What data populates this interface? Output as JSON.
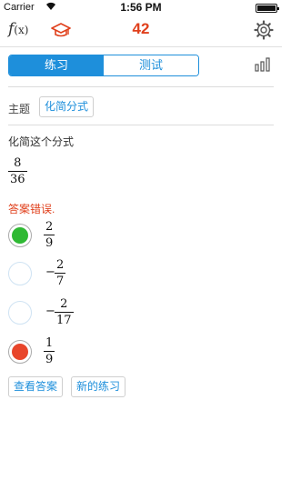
{
  "status": {
    "carrier": "Carrier",
    "time": "1:56 PM"
  },
  "navbar": {
    "fx_icon_main": "f",
    "fx_icon_arg": "(x)",
    "score": "42"
  },
  "tabs": {
    "practice": "练习",
    "test": "测试"
  },
  "topic": {
    "label": "主题",
    "value": "化简分式"
  },
  "question": {
    "prompt": "化简这个分式",
    "fraction": {
      "numerator": "8",
      "denominator": "36"
    }
  },
  "feedback": "答案错误.",
  "options": [
    {
      "sign": "",
      "numerator": "2",
      "denominator": "9",
      "state": "correct"
    },
    {
      "sign": "−",
      "numerator": "2",
      "denominator": "7",
      "state": "none"
    },
    {
      "sign": "−",
      "numerator": "2",
      "denominator": "17",
      "state": "none"
    },
    {
      "sign": "",
      "numerator": "1",
      "denominator": "9",
      "state": "wrong"
    }
  ],
  "buttons": {
    "view_answer": "查看答案",
    "new_practice": "新的练习"
  },
  "colors": {
    "accent": "#1e8fdb",
    "error": "#e0401c",
    "correct": "#2fb933",
    "wrong": "#e8452a"
  },
  "icons": {
    "graduation": "graduation-cap-icon",
    "settings": "gear-icon",
    "stats": "bar-chart-icon"
  }
}
